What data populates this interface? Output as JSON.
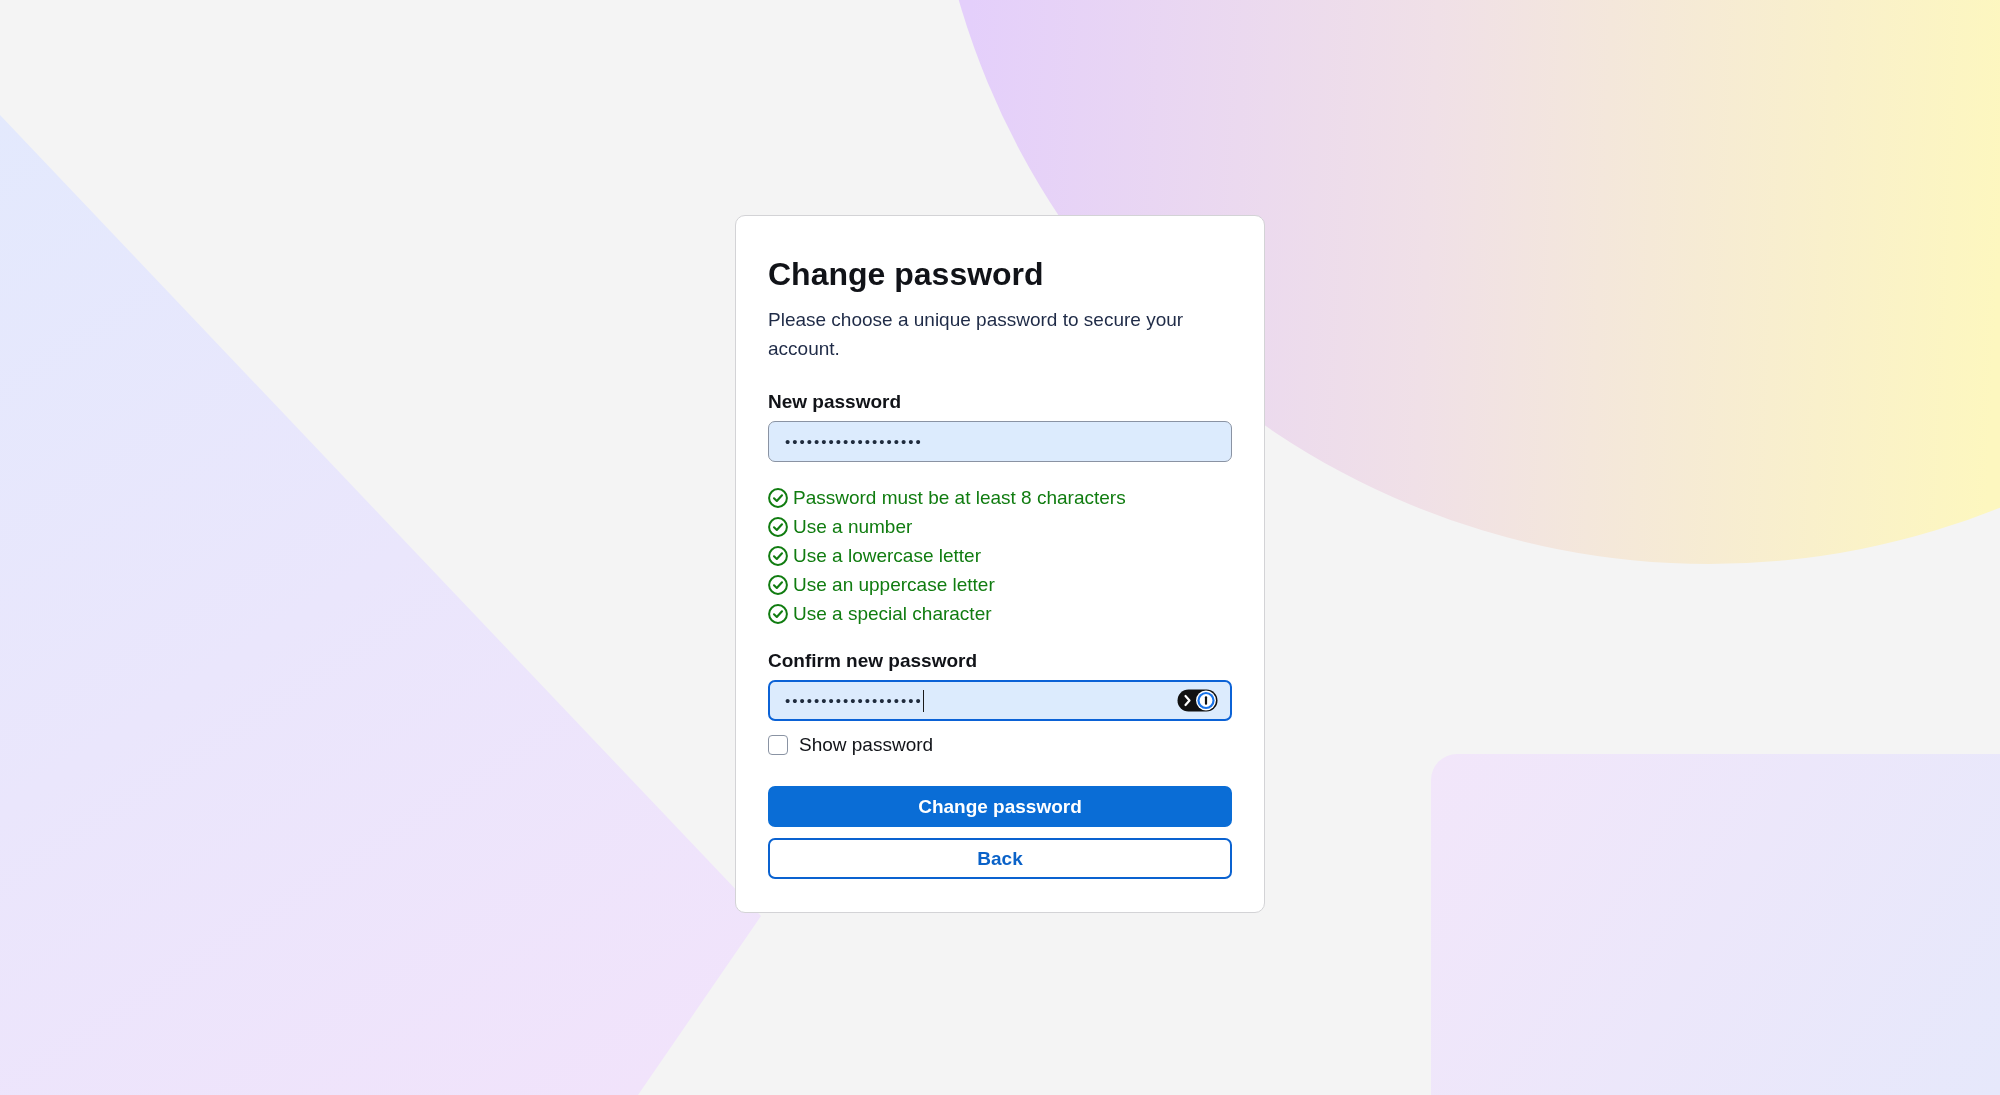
{
  "card": {
    "title": "Change password",
    "description": "Please choose a unique password to secure your account.",
    "new_password": {
      "label": "New password",
      "value": "•••••••••••••••••••",
      "focused": false
    },
    "requirements": [
      {
        "text": "Password must be at least 8 characters",
        "met": true
      },
      {
        "text": "Use a number",
        "met": true
      },
      {
        "text": "Use a lowercase letter",
        "met": true
      },
      {
        "text": "Use an uppercase letter",
        "met": true
      },
      {
        "text": "Use a special character",
        "met": true
      }
    ],
    "confirm_password": {
      "label": "Confirm new password",
      "value": "•••••••••••••••••••",
      "focused": true
    },
    "show_password": {
      "label": "Show password",
      "checked": false
    },
    "buttons": [
      {
        "label": "Change password",
        "kind": "primary"
      },
      {
        "label": "Back",
        "kind": "secondary"
      }
    ]
  }
}
